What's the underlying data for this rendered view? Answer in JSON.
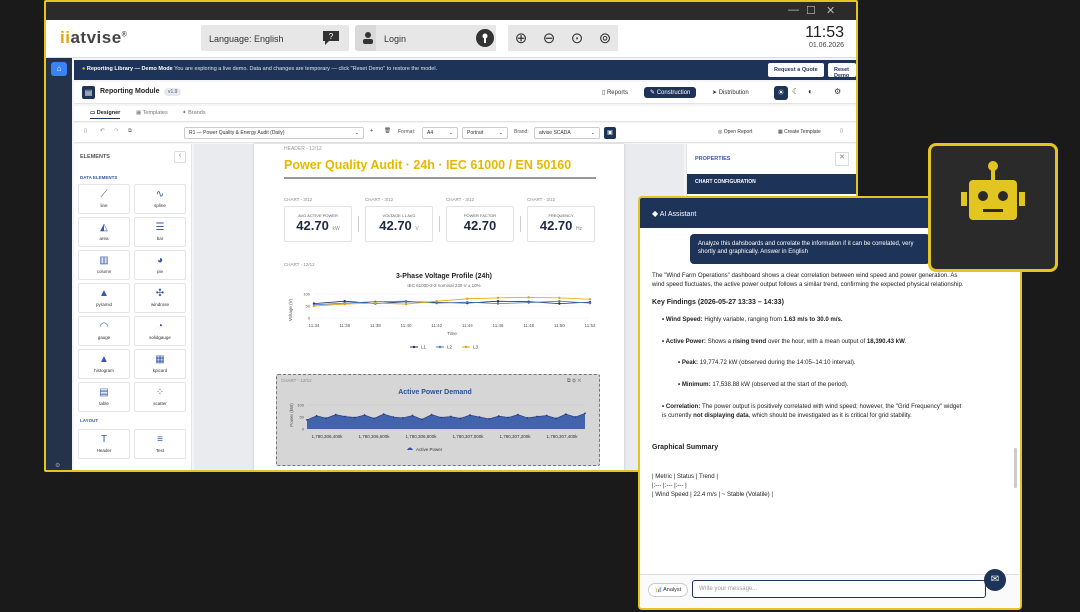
{
  "window": {
    "controls": [
      "—",
      "☐",
      "✕"
    ]
  },
  "topbar": {
    "logo_prefix": "ii",
    "logo_text": "atvise",
    "logo_mark": "®",
    "language_label": "Language: English",
    "login_label": "Login",
    "time": "11:53",
    "date": "01.06.2026"
  },
  "banner": {
    "title": "Reporting Library — Demo Mode",
    "text": "You are exploring a live demo. Data and changes are temporary — click \"Reset Demo\" to restore the model.",
    "quote_button": "Request a Quote",
    "reset_button": "Reset Demo"
  },
  "module": {
    "title": "Reporting Module",
    "version": "v1.9",
    "nav": [
      "Reports",
      "Construction",
      "Distribution"
    ],
    "active_nav": "Construction"
  },
  "tabs": [
    "Designer",
    "Templates",
    "Brands"
  ],
  "toolbar": {
    "report_select": "R1 — Power Quality & Energy Audit (Daily)",
    "format_label": "Format:",
    "format_value": "A4",
    "orientation_value": "Portrait",
    "brand_label": "Brand:",
    "brand_value": "atvise SCADA",
    "open_report": "Open Report",
    "create_template": "Create Template"
  },
  "elements_panel": {
    "title": "ELEMENTS",
    "data_elements_title": "DATA ELEMENTS",
    "items": [
      {
        "label": "line",
        "icon": "line-chart-icon"
      },
      {
        "label": "spline",
        "icon": "spline-chart-icon"
      },
      {
        "label": "area",
        "icon": "area-chart-icon"
      },
      {
        "label": "bar",
        "icon": "bar-chart-icon"
      },
      {
        "label": "column",
        "icon": "column-chart-icon"
      },
      {
        "label": "pie",
        "icon": "pie-chart-icon"
      },
      {
        "label": "pyramid",
        "icon": "pyramid-icon"
      },
      {
        "label": "windrose",
        "icon": "windrose-icon"
      },
      {
        "label": "gauge",
        "icon": "gauge-icon"
      },
      {
        "label": "solidgauge",
        "icon": "solidgauge-icon"
      },
      {
        "label": "histogram",
        "icon": "histogram-icon"
      },
      {
        "label": "kpicard",
        "icon": "kpicard-icon"
      },
      {
        "label": "table",
        "icon": "table-icon"
      },
      {
        "label": "scatter",
        "icon": "scatter-icon"
      }
    ],
    "layout_title": "LAYOUT",
    "layout_items": [
      {
        "label": "Header",
        "icon": "header-icon"
      },
      {
        "label": "Text",
        "icon": "text-icon"
      }
    ]
  },
  "report": {
    "header_label": "HEADER - 12/12",
    "title": "Power Quality Audit · 24h · IEC 61000 / EN 50160",
    "kpis": [
      {
        "chart_label": "CHART - 3/12",
        "label": "AVG ACTIVE POWER",
        "value": "42.70",
        "unit": "kW"
      },
      {
        "chart_label": "CHART - 3/12",
        "label": "VOLTAGE L1 AVG",
        "value": "42.70",
        "unit": "V"
      },
      {
        "chart_label": "CHART - 3/12",
        "label": "POWER FACTOR",
        "value": "42.70",
        "unit": ""
      },
      {
        "chart_label": "CHART - 3/12",
        "label": "FREQUENCY",
        "value": "42.70",
        "unit": "Hz"
      }
    ],
    "voltage_chart_label": "CHART - 12/12",
    "power_chart_label": "CHART - 12/12"
  },
  "chart_data": [
    {
      "type": "line",
      "title": "3-Phase Voltage Profile (24h)",
      "subtitle": "IEC 61000-2-2 nominal 230 V ± 10%",
      "xlabel": "Time",
      "ylabel": "Voltage (V)",
      "x": [
        "11:34",
        "11:36",
        "11:38",
        "11:40",
        "11:42",
        "11:44",
        "11:46",
        "11:48",
        "11:50",
        "11:52"
      ],
      "ylim": [
        0,
        100
      ],
      "yticks": [
        0,
        50,
        100
      ],
      "series": [
        {
          "name": "L1",
          "color": "#1e3358",
          "values": [
            60,
            70,
            60,
            68,
            65,
            62,
            70,
            68,
            60,
            66
          ]
        },
        {
          "name": "L2",
          "color": "#4a78c2",
          "values": [
            55,
            62,
            68,
            70,
            62,
            66,
            60,
            64,
            70,
            62
          ]
        },
        {
          "name": "L3",
          "color": "#e6a400",
          "values": [
            50,
            58,
            62,
            58,
            70,
            80,
            84,
            86,
            84,
            78
          ]
        }
      ]
    },
    {
      "type": "area",
      "title": "Active Power Demand",
      "ylabel": "Power (kW)",
      "x": [
        "1,780,306,400k",
        "1,780,306,600k",
        "1,780,306,800k",
        "1,780,307,000k",
        "1,780,307,200k",
        "1,780,307,400k"
      ],
      "ylim": [
        0,
        100
      ],
      "yticks": [
        0,
        50,
        100
      ],
      "series": [
        {
          "name": "Active Power",
          "color": "#3356a8",
          "values": [
            38,
            55,
            45,
            60,
            52,
            48,
            58,
            44,
            62,
            50,
            46,
            56,
            40,
            60,
            48,
            52,
            44,
            58,
            50,
            42,
            54,
            48,
            60,
            46,
            52,
            56,
            44,
            62,
            50,
            65
          ]
        }
      ]
    }
  ],
  "properties": {
    "title": "PROPERTIES",
    "section": "CHART CONFIGURATION"
  },
  "ai": {
    "title": "AI Assistant",
    "user_message": "Analyze this dahsboards and correlate the information if it can be correlated, very shortly and graphically. Answer in English",
    "intro": "The \"Wind Farm Operations\" dashboard shows a clear correlation between wind speed and power generation. As wind speed fluctuates, the active power output follows a similar trend, confirming the expected physical relationship.",
    "findings_title": "Key Findings (2026-05-27 13:33 – 14:33)",
    "wind_label": "Wind Speed:",
    "wind_text": "Highly variable, ranging from",
    "wind_range": "1.63 m/s to 30.0 m/s.",
    "power_label": "Active Power:",
    "power_text_a": "Shows a",
    "power_trend": "rising trend",
    "power_text_b": "over the hour, with a mean output of",
    "power_mean": "18,390.43 kW",
    "peak_label": "Peak:",
    "peak_text": "19,774.72 kW (observed during the 14:05–14:10 interval).",
    "min_label": "Minimum:",
    "min_text": "17,538.88 kW (observed at the start of the period).",
    "corr_label": "Correlation:",
    "corr_text_a": "The power output is positively correlated with wind speed; however, the \"Grid Frequency\" widget is currently",
    "corr_bold": "not displaying data",
    "corr_text_b": ", which should be investigated as it is critical for grid stability.",
    "graph_title": "Graphical Summary",
    "table_row1": "| Metric | Status | Trend |",
    "table_row2": "|:--- |:--- |:--- |",
    "table_row3": "| Wind Speed | 22.4 m/s | ~ Stable (Volatile) |",
    "analyst_label": "Analyst",
    "input_placeholder": "Write your message..."
  }
}
